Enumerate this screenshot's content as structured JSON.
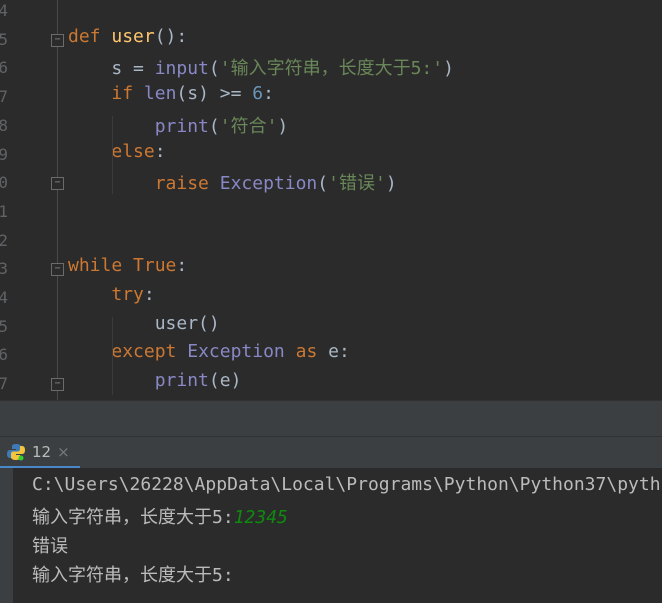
{
  "editor": {
    "line_numbers": [
      "4",
      "5",
      "6",
      "7",
      "8",
      "9",
      "0",
      "1",
      "2",
      "3",
      "4",
      "5",
      "6",
      "7"
    ],
    "lines": [
      [],
      [
        {
          "t": "def",
          "c": "kw"
        },
        {
          "t": " "
        },
        {
          "t": "user",
          "c": "fn"
        },
        {
          "t": "():"
        }
      ],
      [
        {
          "t": "    s = "
        },
        {
          "t": "input",
          "c": "bi"
        },
        {
          "t": "("
        },
        {
          "t": "'输入字符串，长度大于5:'",
          "c": "str"
        },
        {
          "t": ")"
        }
      ],
      [
        {
          "t": "    "
        },
        {
          "t": "if",
          "c": "kw"
        },
        {
          "t": " "
        },
        {
          "t": "len",
          "c": "bi"
        },
        {
          "t": "(s) >= "
        },
        {
          "t": "6",
          "c": "num"
        },
        {
          "t": ":"
        }
      ],
      [
        {
          "t": "        "
        },
        {
          "t": "print",
          "c": "bi"
        },
        {
          "t": "("
        },
        {
          "t": "'符合'",
          "c": "str"
        },
        {
          "t": ")"
        }
      ],
      [
        {
          "t": "    "
        },
        {
          "t": "else",
          "c": "kw"
        },
        {
          "t": ":"
        }
      ],
      [
        {
          "t": "        "
        },
        {
          "t": "raise",
          "c": "kw"
        },
        {
          "t": " "
        },
        {
          "t": "Exception",
          "c": "bi"
        },
        {
          "t": "("
        },
        {
          "t": "'错误'",
          "c": "str"
        },
        {
          "t": ")"
        }
      ],
      [],
      [],
      [
        {
          "t": "while",
          "c": "kw"
        },
        {
          "t": " "
        },
        {
          "t": "True",
          "c": "kw"
        },
        {
          "t": ":"
        }
      ],
      [
        {
          "t": "    "
        },
        {
          "t": "try",
          "c": "kw"
        },
        {
          "t": ":"
        }
      ],
      [
        {
          "t": "        user()"
        }
      ],
      [
        {
          "t": "    "
        },
        {
          "t": "except",
          "c": "kw"
        },
        {
          "t": " "
        },
        {
          "t": "Exception",
          "c": "bi"
        },
        {
          "t": " "
        },
        {
          "t": "as",
          "c": "kw"
        },
        {
          "t": " e:"
        }
      ],
      [
        {
          "t": "        "
        },
        {
          "t": "print",
          "c": "bi"
        },
        {
          "t": "(e)"
        }
      ]
    ]
  },
  "run_tab": {
    "label": "12",
    "icon": "python-icon",
    "close": "×"
  },
  "console": {
    "path": "C:\\Users\\26228\\AppData\\Local\\Programs\\Python\\Python37\\pyth",
    "prompt1": "输入字符串，长度大于5:",
    "input1": "12345",
    "error": "错误",
    "prompt2": "输入字符串，长度大于5:"
  },
  "colors": {
    "keyword": "#cc7832",
    "function": "#ffc66d",
    "builtin": "#8888c6",
    "string": "#6a8759",
    "number": "#6897bb",
    "user_input": "#0f8a0f",
    "accent": "#4a88c7"
  }
}
